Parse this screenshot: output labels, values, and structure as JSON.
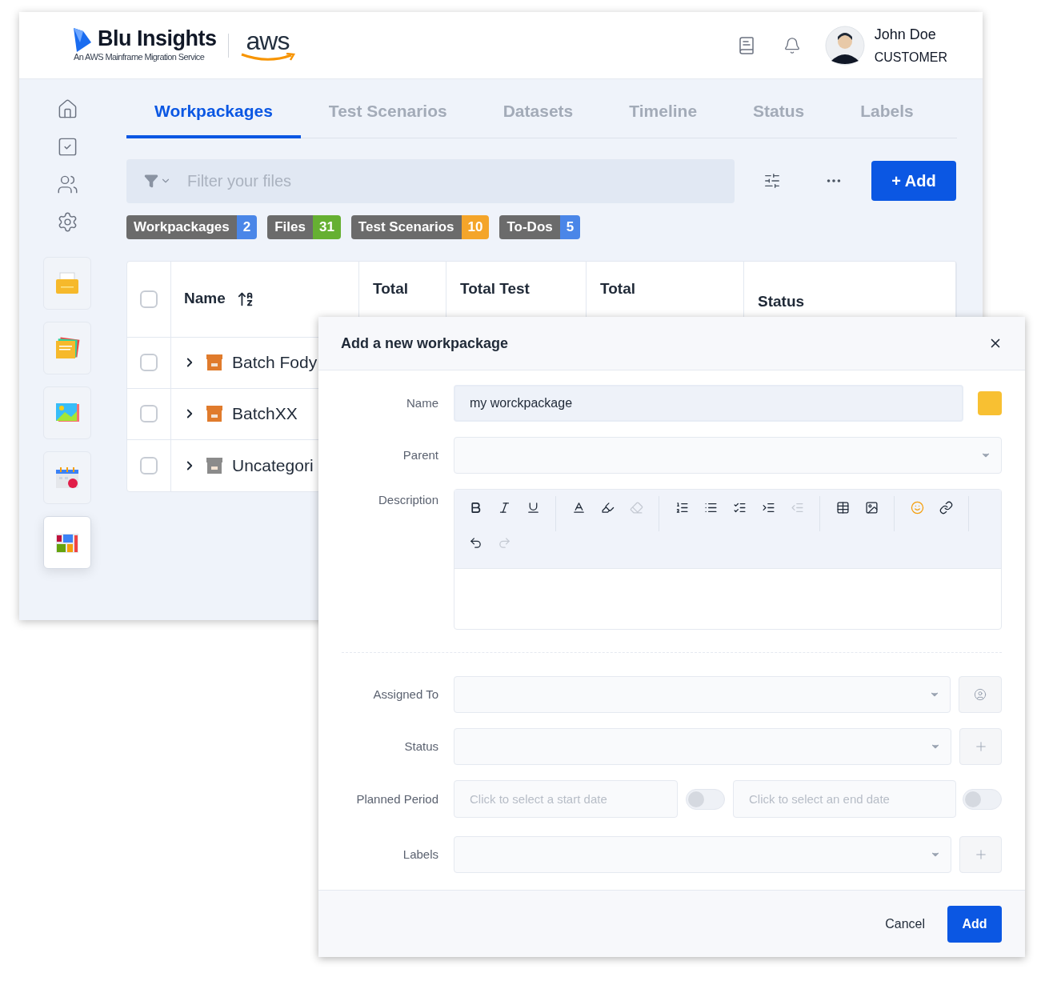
{
  "header": {
    "brand": "Blu Insights",
    "brand_subtitle": "An AWS Mainframe Migration Service",
    "partner": "aws",
    "user": {
      "name": "John Doe",
      "role": "CUSTOMER"
    }
  },
  "sidebar": {
    "nav": [
      {
        "kind": "home"
      },
      {
        "kind": "tasks"
      },
      {
        "kind": "users"
      },
      {
        "kind": "settings"
      }
    ],
    "apps": [
      {
        "kind": "folder",
        "selected": false
      },
      {
        "kind": "notes",
        "selected": false
      },
      {
        "kind": "gallery",
        "selected": false
      },
      {
        "kind": "calendar",
        "selected": false
      },
      {
        "kind": "board",
        "selected": true
      }
    ]
  },
  "tabs": [
    {
      "label": "Workpackages",
      "selected": true
    },
    {
      "label": "Test Scenarios",
      "selected": false
    },
    {
      "label": "Datasets",
      "selected": false
    },
    {
      "label": "Timeline",
      "selected": false
    },
    {
      "label": "Status",
      "selected": false
    },
    {
      "label": "Labels",
      "selected": false
    }
  ],
  "filter": {
    "placeholder": "Filter your files"
  },
  "add_button": "+ Add",
  "counters": [
    {
      "label": "Workpackages",
      "count": "2",
      "color": "#4a86e8"
    },
    {
      "label": "Files",
      "count": "31",
      "color": "#66b032"
    },
    {
      "label": "Test Scenarios",
      "count": "10",
      "color": "#f4a52a"
    },
    {
      "label": "To-Dos",
      "count": "5",
      "color": "#4a86e8"
    }
  ],
  "table": {
    "all_checked": false,
    "columns": [
      "Name",
      "Total",
      "Total Test",
      "Total",
      "Status"
    ],
    "rows": [
      {
        "name": "Batch Fody",
        "checked": false,
        "kind": "batch"
      },
      {
        "name": "BatchXX",
        "checked": false,
        "kind": "batch"
      },
      {
        "name": "Uncategori",
        "checked": false,
        "kind": "uncategorized"
      }
    ]
  },
  "dialog": {
    "title": "Add a new workpackage",
    "name": {
      "label": "Name",
      "value": "my worckpackage",
      "color": "#f8c032"
    },
    "parent": {
      "label": "Parent"
    },
    "description": {
      "label": "Description",
      "toolbar": [
        [
          {
            "kind": "bold",
            "disabled": false
          },
          {
            "kind": "italic",
            "disabled": false
          },
          {
            "kind": "underline",
            "disabled": false
          }
        ],
        [
          {
            "kind": "text-color",
            "disabled": false
          },
          {
            "kind": "highlight",
            "disabled": false
          },
          {
            "kind": "eraser",
            "disabled": true
          }
        ],
        [
          {
            "kind": "ordered-list",
            "disabled": false
          },
          {
            "kind": "bullet-list",
            "disabled": false
          },
          {
            "kind": "check-list",
            "disabled": false
          },
          {
            "kind": "indent",
            "disabled": false
          },
          {
            "kind": "outdent",
            "disabled": true
          }
        ],
        [
          {
            "kind": "table",
            "disabled": false
          },
          {
            "kind": "image",
            "disabled": false
          }
        ],
        [
          {
            "kind": "emoji",
            "disabled": false
          },
          {
            "kind": "link",
            "disabled": false
          }
        ],
        [
          {
            "kind": "undo",
            "disabled": false
          },
          {
            "kind": "redo",
            "disabled": true
          }
        ]
      ]
    },
    "assigned_to": {
      "label": "Assigned To"
    },
    "status": {
      "label": "Status"
    },
    "planned_period": {
      "label": "Planned Period",
      "start": {
        "placeholder": "Click to select a start date",
        "on": false
      },
      "end": {
        "placeholder": "Click to select an end date",
        "on": false
      }
    },
    "labels": {
      "label": "Labels"
    },
    "buttons": {
      "cancel": "Cancel",
      "confirm": "Add"
    }
  }
}
